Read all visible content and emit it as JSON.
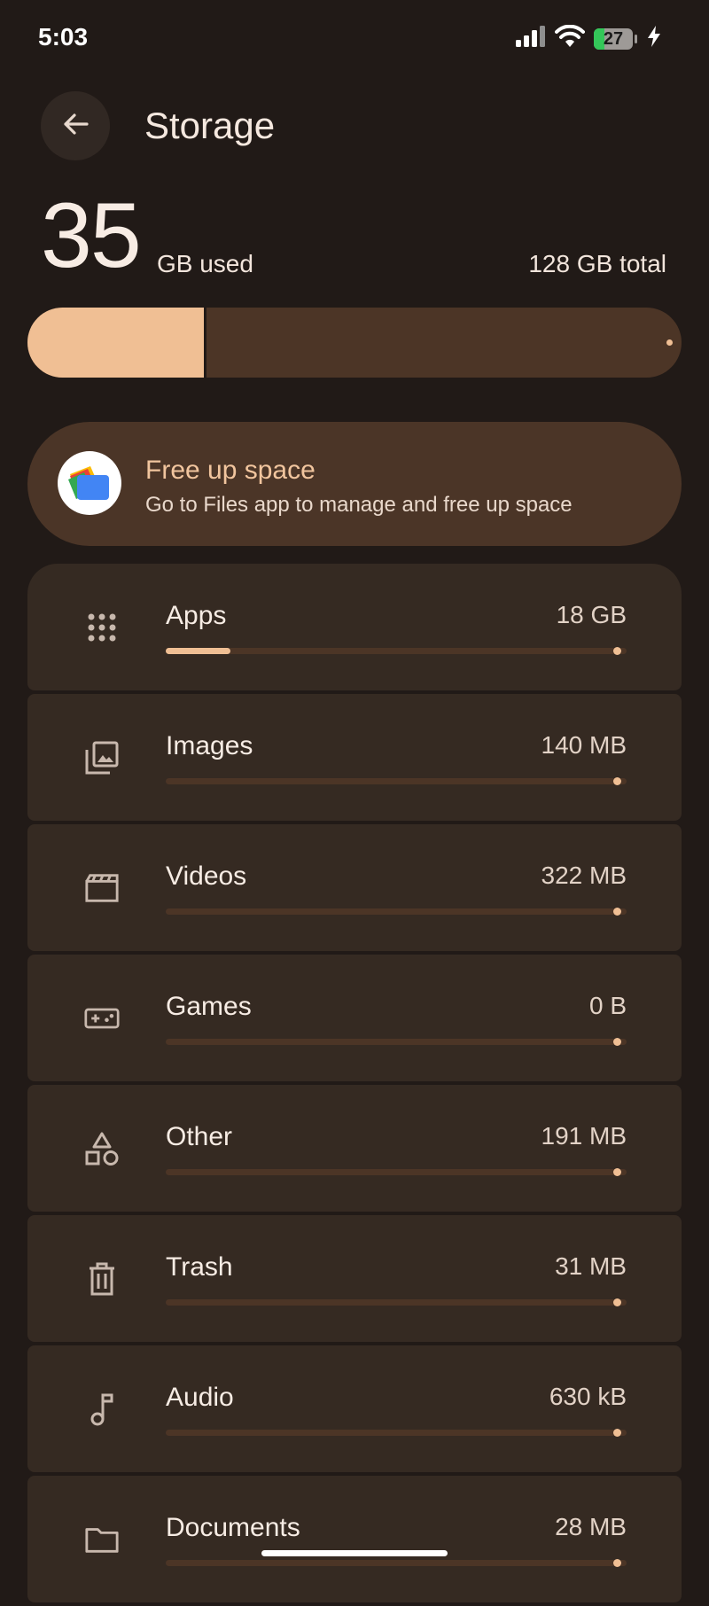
{
  "status_bar": {
    "time": "5:03",
    "battery_percent": 27,
    "battery_text": "27",
    "icons": [
      "cellular-signal-icon",
      "wifi-icon",
      "battery-icon",
      "charging-bolt-icon"
    ]
  },
  "header": {
    "title": "Storage",
    "back_icon": "arrow-left-icon"
  },
  "usage": {
    "used_number": "35",
    "used_unit": "GB used",
    "total": "128 GB total",
    "used_fraction": 0.27
  },
  "free_up": {
    "title": "Free up space",
    "subtitle": "Go to Files app to manage and free up space",
    "icon": "files-app-icon"
  },
  "categories": [
    {
      "label": "Apps",
      "size": "18 GB",
      "icon": "apps-grid-icon",
      "fraction": 0.14
    },
    {
      "label": "Images",
      "size": "140 MB",
      "icon": "images-icon",
      "fraction": 0.0
    },
    {
      "label": "Videos",
      "size": "322 MB",
      "icon": "videos-icon",
      "fraction": 0.0
    },
    {
      "label": "Games",
      "size": "0 B",
      "icon": "gamepad-icon",
      "fraction": 0.0
    },
    {
      "label": "Other",
      "size": "191 MB",
      "icon": "shapes-icon",
      "fraction": 0.0
    },
    {
      "label": "Trash",
      "size": "31 MB",
      "icon": "trash-icon",
      "fraction": 0.0
    },
    {
      "label": "Audio",
      "size": "630 kB",
      "icon": "music-note-icon",
      "fraction": 0.0
    },
    {
      "label": "Documents",
      "size": "28 MB",
      "icon": "folder-icon",
      "fraction": 0.0
    }
  ],
  "colors": {
    "background": "#211a17",
    "accent": "#f0bf94",
    "track": "#4c3526",
    "card": "#352a22",
    "free_card": "#4b3527"
  }
}
